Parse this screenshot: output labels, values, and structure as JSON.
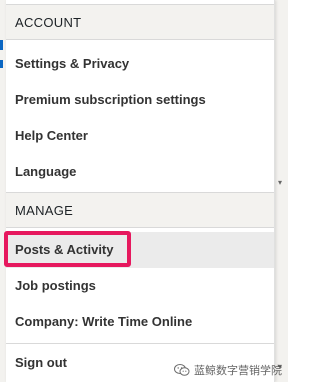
{
  "menu": {
    "sections": [
      {
        "header": "ACCOUNT",
        "items": [
          {
            "label": "Settings & Privacy"
          },
          {
            "label": "Premium subscription settings"
          },
          {
            "label": "Help Center"
          },
          {
            "label": "Language"
          }
        ]
      },
      {
        "header": "MANAGE",
        "items": [
          {
            "label": "Posts & Activity",
            "state": "hovered/highlighted"
          },
          {
            "label": "Job postings"
          },
          {
            "label": "Company: Write Time Online"
          }
        ]
      }
    ],
    "signout_label": "Sign out"
  },
  "annotation": {
    "highlight_color": "#e6185e"
  },
  "watermark": {
    "text": "蓝鲸数字营销学院",
    "icon": "wechat-icon"
  },
  "colors": {
    "section_header_bg": "#f3f2ef",
    "active_row_bg": "#ebebeb",
    "text": "#333333"
  }
}
